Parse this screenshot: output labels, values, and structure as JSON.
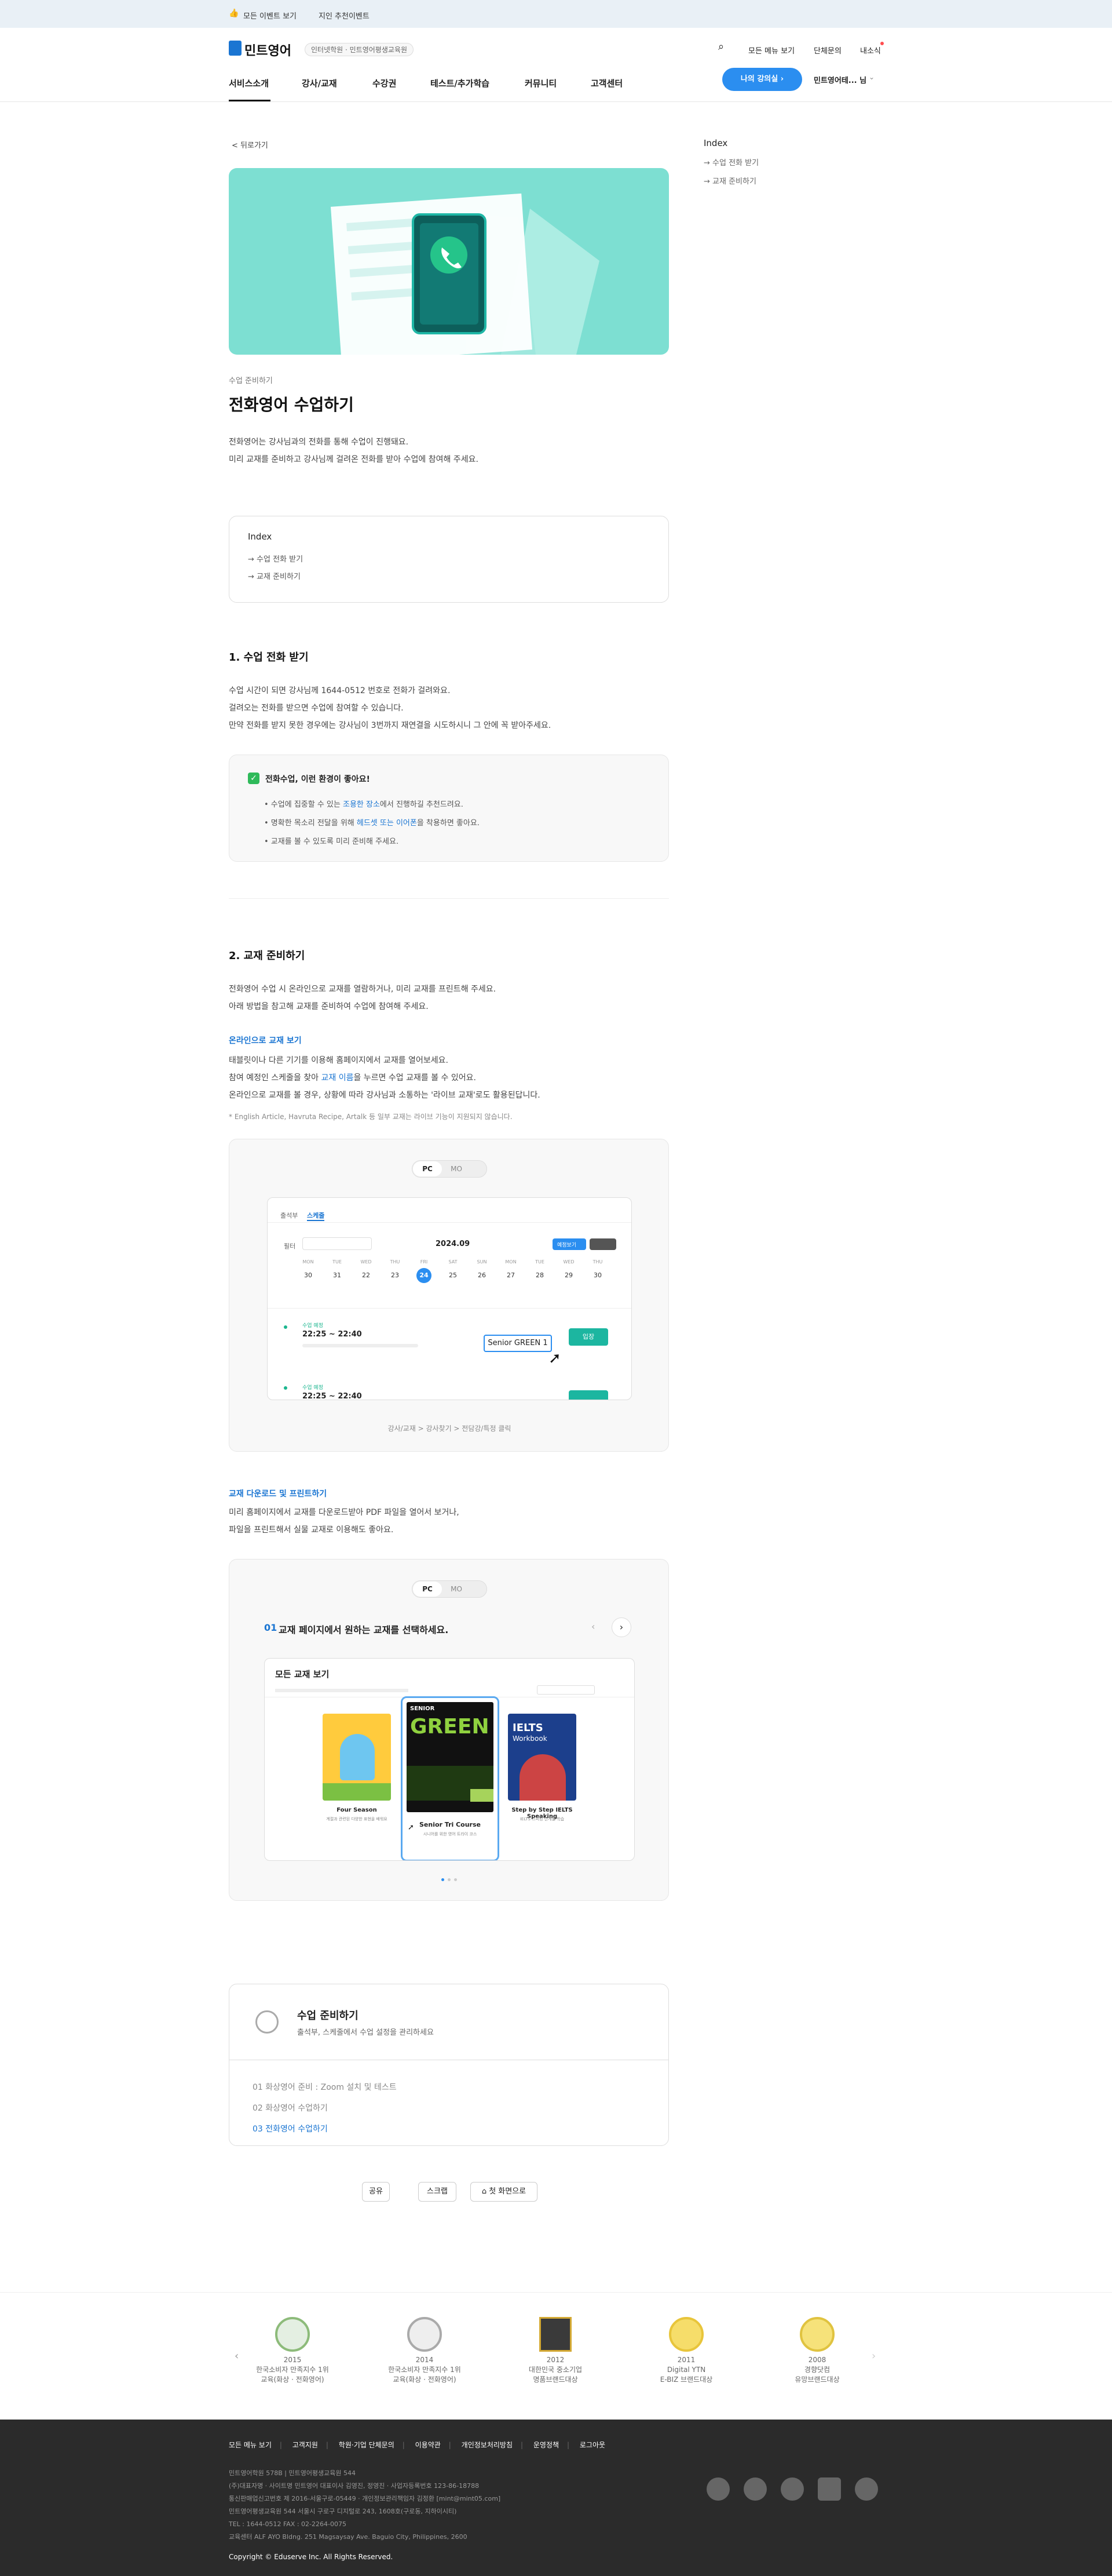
{
  "topbar": {
    "events": "모든 이벤트 보기",
    "recommend": "지인 추천이벤트"
  },
  "header": {
    "brand": "민트영어",
    "badge": "인터넷학원 · 민트영어평생교육원",
    "links": [
      "모든 메뉴 보기",
      "단체문의",
      "내소식"
    ],
    "nav": [
      "서비스소개",
      "강사/교재",
      "수강권",
      "테스트/추가학습",
      "커뮤니티",
      "고객센터"
    ],
    "cta": "나의 강의실 ›",
    "user": "민트영어테... 님"
  },
  "sidebar": {
    "title": "Index",
    "items": [
      "→ 수업 전화 받기",
      "→ 교재 준비하기"
    ]
  },
  "article": {
    "back": "< 뒤로가기",
    "category": "수업 준비하기",
    "title": "전화영어 수업하기",
    "intro": [
      "전화영어는 강사님과의 전화를 통해 수업이 진행돼요.",
      "미리 교재를 준비하고 강사님께 걸려온 전화를 받아 수업에 참여해 주세요."
    ],
    "index_title": "Index",
    "index_items": [
      "→ 수업 전화 받기",
      "→ 교재 준비하기"
    ],
    "s1_title": "1. 수업 전화 받기",
    "s1_body": [
      "수업 시간이 되면 강사님께 1644-0512 번호로 전화가 걸려와요.",
      "걸려오는 전화를 받으면 수업에 참여할 수 있습니다.",
      "만약 전화를 받지 못한 경우에는 강사님이 3번까지 재연결을 시도하시니 그 안에 꼭 받아주세요."
    ],
    "tip_title": "전화수업, 이런 환경이 좋아요!",
    "tips": [
      [
        "• 수업에 집중할 수 있는 ",
        "조용한 장소",
        "에서 진행하길 추천드려요."
      ],
      [
        "• 명확한 목소리 전달을 위해 ",
        "헤드셋 또는 이어폰",
        "을 착용하면 좋아요."
      ],
      [
        "• 교재를 볼 수 있도록 미리 준비해 주세요.",
        "",
        ""
      ]
    ],
    "s2_title": "2. 교재 준비하기",
    "s2_body": [
      "전화영어 수업 시 온라인으로 교재를 열람하거나, 미리 교재를 프린트해 주세요.",
      "아래 방법을 참고해 교재를 준비하여 수업에 참여해 주세요."
    ],
    "online_title": "온라인으로 교재 보기",
    "online_body": [
      "태블릿이나 다른 기기를 이용해 홈페이지에서 교재를 열어보세요.",
      "참여 예정인 스케줄을 찾아 ",
      "교재 이름",
      "을 누르면 수업 교재를 볼 수 있어요.",
      "온라인으로 교재를 볼 경우, 상황에 따라 강사님과 소통하는 '라이브 교재'로도 활용된답니다."
    ],
    "online_note": "* English Article, Havruta Recipe, Artalk 등 일부 교재는 라이브 기능이 지원되지 않습니다.",
    "toggle": [
      "PC",
      "MO"
    ],
    "shot1": {
      "tabs": [
        "출석부",
        "스케줄"
      ],
      "month": "2024.09",
      "days": [
        "SUN",
        "MON",
        "TUE",
        "WED",
        "THU",
        "FRI",
        "SAT",
        "SUN",
        "MON",
        "TUE",
        "WED",
        "THU"
      ],
      "dates": [
        "30",
        "31",
        "22",
        "23",
        "24",
        "25",
        "26",
        "27",
        "28",
        "29",
        "30"
      ],
      "time1": "22:25 ~ 22:40",
      "time2": "22:25 ~ 22:40",
      "label": "수업 예정",
      "tooltip": "Senior GREEN 1",
      "btn": "입장",
      "filter": "필터",
      "upcoming": "예정보기",
      "caption": "강사/교재 > 강사찾기 > 전담강/특정 클릭"
    },
    "download_title": "교재 다운로드 및 프린트하기",
    "download_body": [
      "미리 홈페이지에서 교재를 다운로드받아 PDF 파일을 열어서 보거나,",
      "파일을 프린트해서 실물 교재로 이용해도 좋아요."
    ],
    "shot2": {
      "step_no": "01",
      "step": "교재 페이지에서 원하는 교재를 선택하세요.",
      "heading": "모든 교재 보기",
      "books": [
        {
          "title": "Four Season",
          "desc": "계절과 관련된 다양한 표현을 배워요"
        },
        {
          "title": "Senior Tri Course",
          "desc": "시니어를 위한 영어 트라이 코스"
        },
        {
          "title": "Step by Step IELTS Speaking",
          "desc": "IELTS 스피킹 단계별 학습"
        }
      ],
      "cover_green": "GREEN",
      "cover_senior": "SENIOR",
      "cover_ielts": "IELTS",
      "cover_workbook": "Workbook"
    },
    "guide_title": "수업 준비하기",
    "guide_sub": "출석부, 스케줄에서 수업 설정을 관리하세요",
    "guide_items": [
      "01  화상영어 준비 : Zoom 설치 및 테스트",
      "02  화상영어 수업하기",
      "03  전화영어 수업하기"
    ],
    "actions": [
      "공유",
      "스크랩",
      "⌂ 첫 화면으로"
    ]
  },
  "awards": [
    {
      "year": "2015",
      "line1": "한국소비자 만족지수 1위",
      "line2": "교육(화상 · 전화영어)"
    },
    {
      "year": "2014",
      "line1": "한국소비자 만족지수 1위",
      "line2": "교육(화상 · 전화영어)"
    },
    {
      "year": "2012",
      "line1": "대한민국 중소기업",
      "line2": "명품브랜드대상"
    },
    {
      "year": "2011",
      "line1": "Digital YTN",
      "line2": "E-BIZ 브랜드대상"
    },
    {
      "year": "2008",
      "line1": "경향닷컴",
      "line2": "유망브랜드대상"
    }
  ],
  "footer": {
    "links": [
      "모든 메뉴 보기",
      "고객지원",
      "학원·기업 단체문의",
      "이용약관",
      "개인정보처리방침",
      "운영정책",
      "로그아웃"
    ],
    "lines": [
      "민트영어학원 578B | 민트영어평생교육원 544",
      "(주)대표자명 · 사이트명 민트영어 대표이사 김영진, 정영진 · 사업자등록번호 123-86-18788",
      "통신판매업신고번호 제 2016-서울구로-05449 · 개인정보관리책임자 김정환 [mint@mint05.com]",
      "민트영어평생교육원 544 서울시 구로구 디지털로 243, 1608호(구로동, 지하이시티)",
      "TEL : 1644-0512  FAX : 02-2264-0075",
      "교육센터 ALF AYO Bldng. 251 Magsaysay Ave. Baguio City, Philippines, 2600"
    ],
    "copyright": "Copyright © Eduserve Inc. All Rights Reserved."
  }
}
